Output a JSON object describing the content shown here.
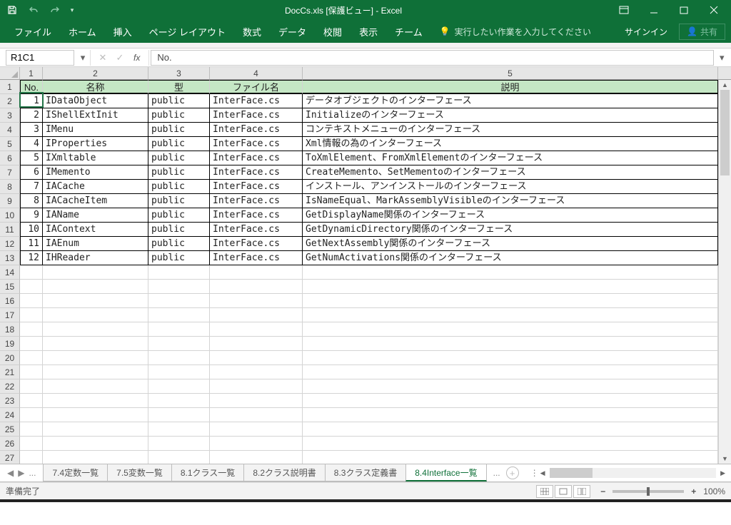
{
  "title": "DocCs.xls [保護ビュー] - Excel",
  "qat": {
    "save": "保存",
    "undo": "元に戻す",
    "redo": "やり直し"
  },
  "ribbon": {
    "tabs": [
      "ファイル",
      "ホーム",
      "挿入",
      "ページ レイアウト",
      "数式",
      "データ",
      "校閲",
      "表示",
      "チーム"
    ],
    "tellme_placeholder": "実行したい作業を入力してください",
    "signin": "サインイン",
    "share": "共有"
  },
  "formula": {
    "namebox": "R1C1",
    "fx": "fx",
    "value": "No."
  },
  "columns": [
    "1",
    "2",
    "3",
    "4",
    "5"
  ],
  "headers": {
    "no": "No.",
    "name": "名称",
    "type": "型",
    "file": "ファイル名",
    "desc": "説明"
  },
  "rows": [
    {
      "no": "1",
      "name": "IDataObject",
      "type": "public",
      "file": "InterFace.cs",
      "desc": "データオブジェクトのインターフェース"
    },
    {
      "no": "2",
      "name": "IShellExtInit",
      "type": "public",
      "file": "InterFace.cs",
      "desc": "Initializeのインターフェース"
    },
    {
      "no": "3",
      "name": "IMenu",
      "type": "public",
      "file": "InterFace.cs",
      "desc": "コンテキストメニューのインターフェース"
    },
    {
      "no": "4",
      "name": "IProperties",
      "type": "public",
      "file": "InterFace.cs",
      "desc": "Xml情報の為のインターフェース"
    },
    {
      "no": "5",
      "name": "IXmltable",
      "type": "public",
      "file": "InterFace.cs",
      "desc": "ToXmlElement、FromXmlElementのインターフェース"
    },
    {
      "no": "6",
      "name": "IMemento",
      "type": "public",
      "file": "InterFace.cs",
      "desc": "CreateMemento、SetMementoのインターフェース"
    },
    {
      "no": "7",
      "name": "IACache",
      "type": "public",
      "file": "InterFace.cs",
      "desc": "インストール、アンインストールのインターフェース"
    },
    {
      "no": "8",
      "name": "IACacheItem",
      "type": "public",
      "file": "InterFace.cs",
      "desc": "IsNameEqual、MarkAssemblyVisibleのインターフェース"
    },
    {
      "no": "9",
      "name": "IAName",
      "type": "public",
      "file": "InterFace.cs",
      "desc": "GetDisplayName関係のインターフェース"
    },
    {
      "no": "10",
      "name": "IAContext",
      "type": "public",
      "file": "InterFace.cs",
      "desc": "GetDynamicDirectory関係のインターフェース"
    },
    {
      "no": "11",
      "name": "IAEnum",
      "type": "public",
      "file": "InterFace.cs",
      "desc": "GetNextAssembly関係のインターフェース"
    },
    {
      "no": "12",
      "name": "IHReader",
      "type": "public",
      "file": "InterFace.cs",
      "desc": "GetNumActivations関係のインターフェース"
    }
  ],
  "empty_row_count": 14,
  "sheets": {
    "ellipsis": "...",
    "tabs": [
      "7.4定数一覧",
      "7.5変数一覧",
      "8.1クラス一覧",
      "8.2クラス説明書",
      "8.3クラス定義書",
      "8.4Interface一覧"
    ],
    "active_index": 5
  },
  "status": {
    "ready": "準備完了",
    "zoom": "100%"
  }
}
